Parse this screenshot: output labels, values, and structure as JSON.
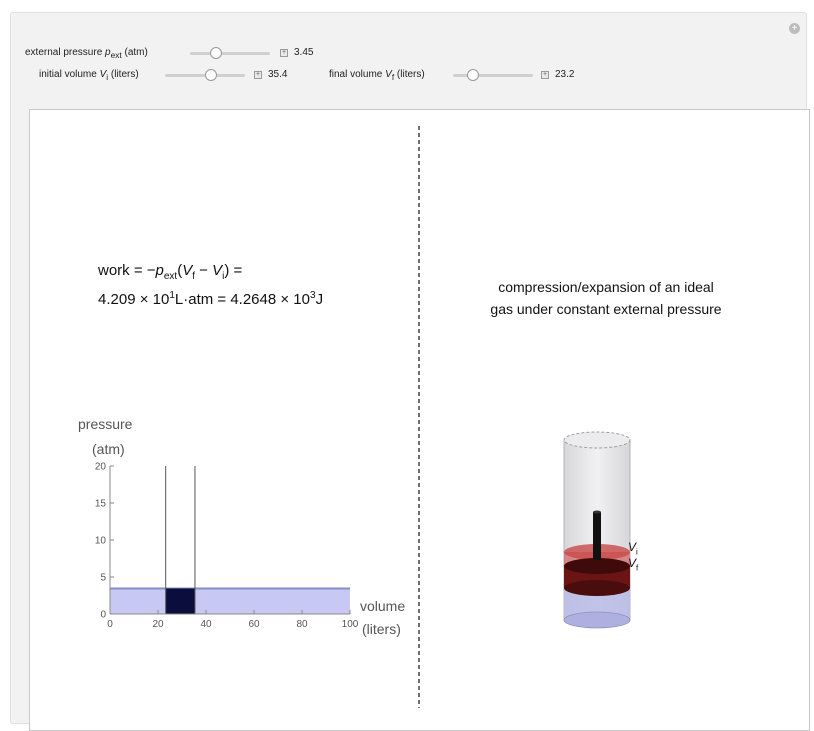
{
  "controls": {
    "external_pressure": {
      "label_prefix": "external pressure ",
      "symbol": "p",
      "sub": "ext",
      "unit": " (atm)",
      "value": "3.45"
    },
    "initial_volume": {
      "label_prefix": "initial volume ",
      "symbol": "V",
      "sub": "i",
      "unit": " (liters)",
      "value": "35.4"
    },
    "final_volume": {
      "label_prefix": "final volume ",
      "symbol": "V",
      "sub": "f",
      "unit": " (liters)",
      "value": "23.2"
    }
  },
  "work": {
    "line1_prefix": "work = −",
    "p": "p",
    "p_sub": "ext",
    "paren_open": "(",
    "vf": "V",
    "vf_sub": "f",
    "minus": " − ",
    "vi": "V",
    "vi_sub": "i",
    "paren_close": ") =",
    "line2_a": "4.209 × 10",
    "line2_exp1": "1",
    "line2_b": "L·atm = 4.2648 × 10",
    "line2_exp2": "3",
    "line2_c": "J"
  },
  "caption": {
    "line1": "compression/expansion of an ideal",
    "line2": "gas under constant external pressure"
  },
  "cylinder_labels": {
    "vi": "V",
    "vi_sub": "i",
    "vf": "V",
    "vf_sub": "f"
  },
  "chart_data": {
    "type": "area",
    "ylabel_line1": "pressure",
    "ylabel_line2": "(atm)",
    "xlabel_line1": "volume",
    "xlabel_line2": "(liters)",
    "xlim": [
      0,
      100
    ],
    "ylim": [
      0,
      20
    ],
    "x_ticks": [
      0,
      20,
      40,
      60,
      80,
      100
    ],
    "y_ticks": [
      0,
      5,
      10,
      15,
      20
    ],
    "pressure": 3.45,
    "v_initial": 35.4,
    "v_final": 23.2,
    "colors": {
      "area": "#c8c8f5",
      "line": "#7f91c2",
      "work": "#0b0e3d"
    }
  }
}
